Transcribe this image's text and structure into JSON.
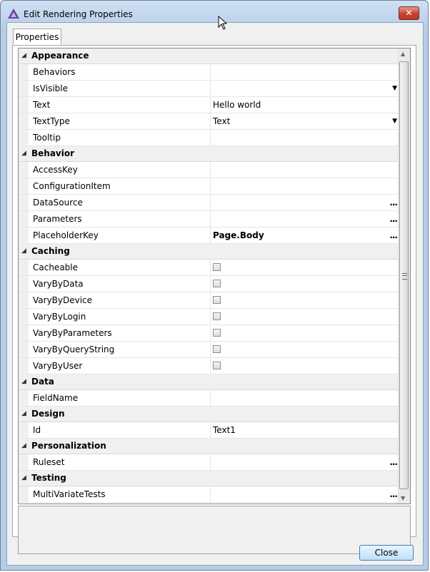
{
  "window": {
    "title": "Edit Rendering Properties",
    "close_glyph": "✕"
  },
  "tabs": [
    {
      "label": "Properties"
    }
  ],
  "categories": [
    {
      "name": "Appearance",
      "rows": [
        {
          "label": "Behaviors",
          "value": ""
        },
        {
          "label": "IsVisible",
          "value": "",
          "dropdown": true
        },
        {
          "label": "Text",
          "value": "Hello world"
        },
        {
          "label": "TextType",
          "value": "Text",
          "dropdown": true
        },
        {
          "label": "Tooltip",
          "value": ""
        }
      ]
    },
    {
      "name": "Behavior",
      "rows": [
        {
          "label": "AccessKey",
          "value": ""
        },
        {
          "label": "ConfigurationItem",
          "value": ""
        },
        {
          "label": "DataSource",
          "value": "",
          "ellipsis": true
        },
        {
          "label": "Parameters",
          "value": "",
          "ellipsis": true
        },
        {
          "label": "PlaceholderKey",
          "value": "Page.Body",
          "bold": true,
          "ellipsis": true
        }
      ]
    },
    {
      "name": "Caching",
      "rows": [
        {
          "label": "Cacheable",
          "checkbox": true
        },
        {
          "label": "VaryByData",
          "checkbox": true
        },
        {
          "label": "VaryByDevice",
          "checkbox": true
        },
        {
          "label": "VaryByLogin",
          "checkbox": true
        },
        {
          "label": "VaryByParameters",
          "checkbox": true
        },
        {
          "label": "VaryByQueryString",
          "checkbox": true
        },
        {
          "label": "VaryByUser",
          "checkbox": true
        }
      ]
    },
    {
      "name": "Data",
      "rows": [
        {
          "label": "FieldName",
          "value": ""
        }
      ]
    },
    {
      "name": "Design",
      "rows": [
        {
          "label": "Id",
          "value": "Text1"
        }
      ]
    },
    {
      "name": "Personalization",
      "rows": [
        {
          "label": "Ruleset",
          "value": "",
          "ellipsis": true
        }
      ]
    },
    {
      "name": "Testing",
      "rows": [
        {
          "label": "MultiVariateTests",
          "value": "",
          "ellipsis": true
        }
      ]
    }
  ],
  "glyphs": {
    "expander": "◢",
    "dropdown": "▼",
    "ellipsis": "...",
    "scroll_up": "▲",
    "scroll_down": "▼"
  },
  "buttons": {
    "close": "Close"
  }
}
